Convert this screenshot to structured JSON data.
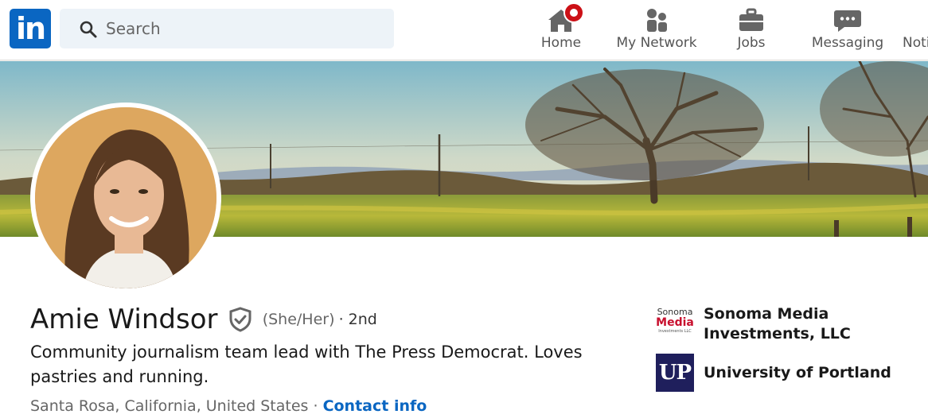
{
  "header": {
    "logo_text": "in",
    "search": {
      "placeholder": "Search"
    },
    "nav": [
      {
        "label": "Home",
        "icon": "home-icon"
      },
      {
        "label": "My Network",
        "icon": "network-icon"
      },
      {
        "label": "Jobs",
        "icon": "briefcase-icon"
      },
      {
        "label": "Messaging",
        "icon": "messaging-icon"
      },
      {
        "label": "Noti",
        "icon": "bell-icon"
      }
    ]
  },
  "profile": {
    "name": "Amie Windsor",
    "pronouns": "(She/Her)",
    "degree": "· 2nd",
    "headline": "Community journalism team lead with The Press Democrat. Loves pastries and running.",
    "location": "Santa Rosa, California, United States",
    "separator": " · ",
    "contact_link": "Contact info"
  },
  "organizations": [
    {
      "name": "Sonoma Media Investments, LLC",
      "logo_text": [
        "Sonoma",
        "Media",
        "Investments LLC"
      ]
    },
    {
      "name": "University of Portland",
      "logo_text": "UP"
    }
  ],
  "colors": {
    "accent": "#0a66c2",
    "notification": "#cc1016",
    "up_navy": "#1f1f5c",
    "sonoma_red": "#c8102e"
  }
}
